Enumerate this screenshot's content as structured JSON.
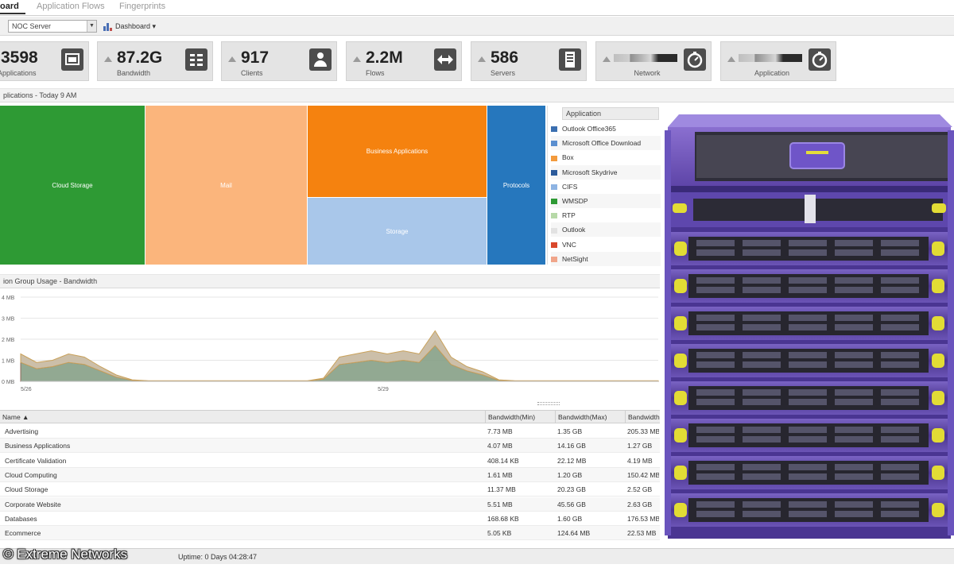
{
  "tabs": [
    {
      "label": "oard",
      "active": true
    },
    {
      "label": "Application Flows",
      "active": false
    },
    {
      "label": "Fingerprints",
      "active": false
    }
  ],
  "toolbar": {
    "site_select": "NOC Server",
    "dashboard_button": "Dashboard ▾"
  },
  "kpis": [
    {
      "value": "3598",
      "label": "Applications",
      "icon": "window-icon"
    },
    {
      "value": "87.2G",
      "label": "Bandwidth",
      "icon": "bandwidth-icon"
    },
    {
      "value": "917",
      "label": "Clients",
      "icon": "user-icon"
    },
    {
      "value": "2.2M",
      "label": "Flows",
      "icon": "arrows-icon"
    },
    {
      "value": "586",
      "label": "Servers",
      "icon": "server-icon"
    },
    {
      "value": "",
      "label": "Network",
      "icon": "stopwatch-icon"
    },
    {
      "value": "",
      "label": "Application",
      "icon": "stopwatch-icon"
    }
  ],
  "treemap": {
    "header": "plications - Today 9 AM",
    "cells": [
      {
        "label": "Cloud Storage",
        "color": "#2e9a34"
      },
      {
        "label": "Mail",
        "color": "#fbb57c"
      },
      {
        "label": "Business Applications",
        "color": "#f5820f"
      },
      {
        "label": "Storage",
        "color": "#a9c7ea"
      },
      {
        "label": "Protocols",
        "color": "#2677bd"
      }
    ]
  },
  "legend": {
    "header": "Application",
    "items": [
      {
        "label": "Outlook Office365",
        "color": "#3b6fb0"
      },
      {
        "label": "Microsoft Office Download",
        "color": "#5a8ecf"
      },
      {
        "label": "Box",
        "color": "#f39a3c"
      },
      {
        "label": "Microsoft Skydrive",
        "color": "#2b5a9a"
      },
      {
        "label": "CIFS",
        "color": "#8eb4e3"
      },
      {
        "label": "WMSDP",
        "color": "#2e9a34"
      },
      {
        "label": "RTP",
        "color": "#b7d9a8"
      },
      {
        "label": "Outlook",
        "color": "#e2e2e2"
      },
      {
        "label": "VNC",
        "color": "#d9472b"
      },
      {
        "label": "NetSight",
        "color": "#f0a58a"
      }
    ]
  },
  "chart": {
    "header": "ion Group Usage - Bandwidth",
    "y_ticks": [
      "0 MB",
      "1 MB",
      "2 MB",
      "3 MB",
      "4 MB"
    ],
    "x_ticks": [
      "5/26",
      "5/29"
    ]
  },
  "chart_data": {
    "type": "area",
    "title": "",
    "xlabel": "",
    "ylabel": "",
    "ylim": [
      0,
      4
    ],
    "x": [
      0,
      1,
      2,
      3,
      4,
      5,
      6,
      7,
      8,
      9,
      10,
      11,
      12,
      13,
      14,
      15,
      16,
      17,
      18,
      19,
      20,
      21,
      22,
      23,
      24,
      25,
      26,
      27,
      28,
      29,
      30,
      31,
      32,
      33,
      34,
      35,
      36,
      37,
      38,
      39,
      40
    ],
    "series": [
      {
        "values": [
          0.9,
          0.6,
          0.7,
          0.9,
          0.8,
          0.5,
          0.2,
          0.05,
          0.02,
          0.02,
          0.02,
          0.02,
          0.02,
          0.02,
          0.02,
          0.02,
          0.02,
          0.02,
          0.02,
          0.1,
          0.8,
          0.9,
          1.0,
          0.9,
          1.0,
          0.9,
          1.7,
          0.8,
          0.5,
          0.3,
          0.05,
          0.02,
          0.02,
          0.02,
          0.02,
          0.02,
          0.02,
          0.02,
          0.02,
          0.02,
          0.02
        ],
        "color": "#7f9a7f"
      },
      {
        "values": [
          0.4,
          0.3,
          0.3,
          0.4,
          0.35,
          0.2,
          0.1,
          0.02,
          0.01,
          0.01,
          0.01,
          0.01,
          0.01,
          0.01,
          0.01,
          0.01,
          0.01,
          0.01,
          0.01,
          0.05,
          0.35,
          0.4,
          0.45,
          0.4,
          0.45,
          0.4,
          0.7,
          0.35,
          0.2,
          0.15,
          0.02,
          0.01,
          0.01,
          0.01,
          0.01,
          0.01,
          0.01,
          0.01,
          0.01,
          0.01,
          0.01
        ],
        "color": "#c6b8a0"
      }
    ]
  },
  "table": {
    "columns": [
      "Name ▲",
      "Bandwidth(Min)",
      "Bandwidth(Max)",
      "Bandwidth"
    ],
    "rows": [
      [
        "Advertising",
        "7.73 MB",
        "1.35 GB",
        "205.33 MB"
      ],
      [
        "Business Applications",
        "4.07 MB",
        "14.16 GB",
        "1.27 GB"
      ],
      [
        "Certificate Validation",
        "408.14 KB",
        "22.12 MB",
        "4.19 MB"
      ],
      [
        "Cloud Computing",
        "1.61 MB",
        "1.20 GB",
        "150.42 MB"
      ],
      [
        "Cloud Storage",
        "11.37 MB",
        "20.23 GB",
        "2.52 GB"
      ],
      [
        "Corporate Website",
        "5.51 MB",
        "45.56 GB",
        "2.63 GB"
      ],
      [
        "Databases",
        "168.68 KB",
        "1.60 GB",
        "176.53 MB"
      ],
      [
        "Ecommerce",
        "5.05 KB",
        "124.64 MB",
        "22.53 MB"
      ]
    ]
  },
  "status": {
    "uptime": "Uptime: 0 Days 04:28:47",
    "copyright": "© Extreme Networks"
  }
}
